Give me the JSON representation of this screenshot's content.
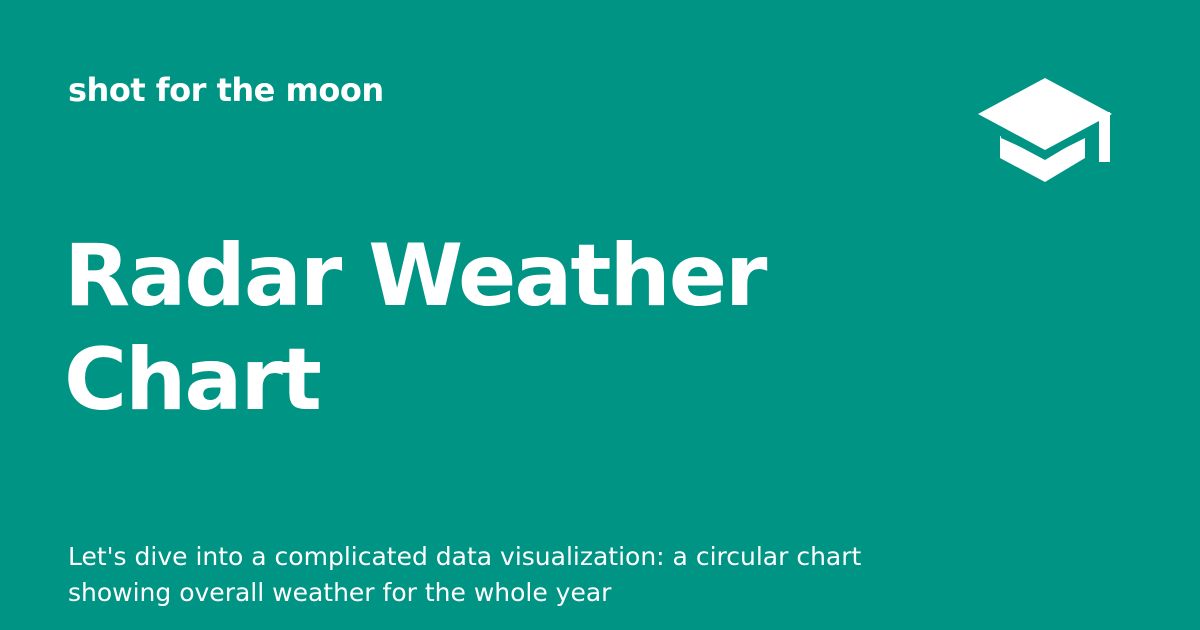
{
  "card": {
    "kicker": "shot for the moon",
    "title_lines": [
      "Radar Weather",
      "Chart"
    ],
    "description_lines": [
      "Let's dive into a complicated data visualization: a circular chart",
      "showing overall weather for the whole year"
    ],
    "logo_icon": "graduation-cap-icon",
    "colors": {
      "background": "#009485",
      "foreground": "#ffffff"
    }
  }
}
